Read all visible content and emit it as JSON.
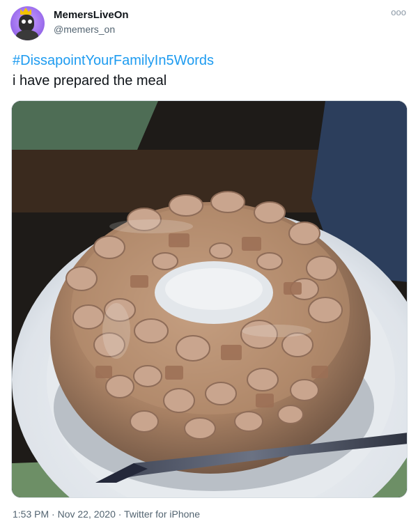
{
  "user": {
    "display_name": "MemersLiveOn",
    "handle": "@memers_on",
    "avatar_icon": "avatar-image"
  },
  "tweet": {
    "hashtag": "#DissapointYourFamilyIn5Words",
    "text": "i have prepared the meal",
    "more_icon": "more-options-icon"
  },
  "media": {
    "alt": "photo of sausage pieces set in a ring-shaped gelatin mold on a white plate with a knife"
  },
  "meta": {
    "timestamp": "1:53 PM · Nov 22, 2020 · Twitter for iPhone"
  },
  "colors": {
    "link": "#1d9bf0",
    "secondary_text": "#536471"
  }
}
